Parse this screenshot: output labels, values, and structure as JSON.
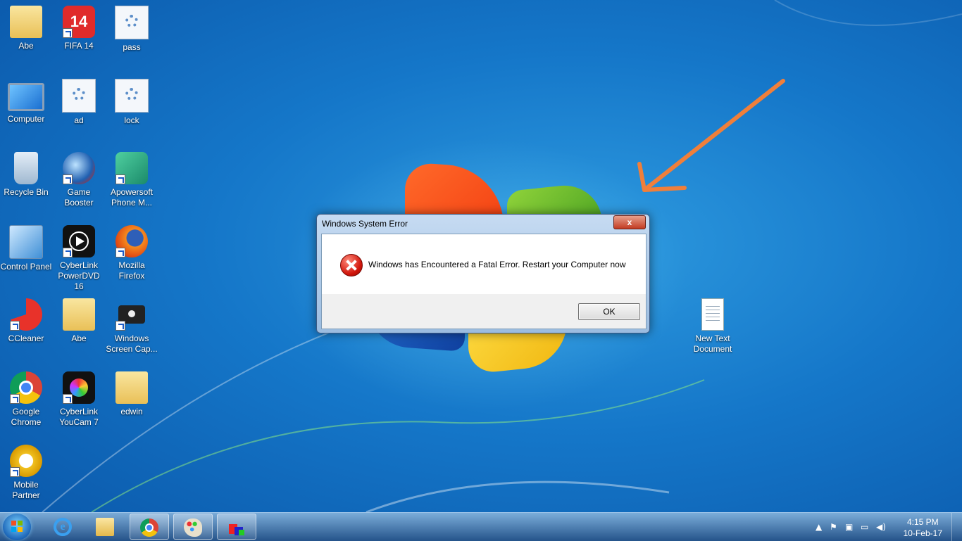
{
  "desktop_icons": [
    {
      "label": "Abe",
      "icon": "user-folder-icon"
    },
    {
      "label": "FIFA 14",
      "icon": "fifa-14-icon"
    },
    {
      "label": "pass",
      "icon": "settings-file-icon"
    },
    {
      "label": "Computer",
      "icon": "computer-icon"
    },
    {
      "label": "ad",
      "icon": "settings-file-icon"
    },
    {
      "label": "lock",
      "icon": "settings-file-icon"
    },
    {
      "label": "Recycle Bin",
      "icon": "recycle-bin-icon"
    },
    {
      "label": "Game Booster",
      "icon": "game-booster-icon"
    },
    {
      "label": "Apowersoft Phone M...",
      "icon": "apowersoft-icon"
    },
    {
      "label": "Control Panel",
      "icon": "control-panel-icon"
    },
    {
      "label": "CyberLink PowerDVD 16",
      "icon": "powerdvd-icon"
    },
    {
      "label": "Mozilla Firefox",
      "icon": "firefox-icon"
    },
    {
      "label": "CCleaner",
      "icon": "ccleaner-icon"
    },
    {
      "label": "Abe",
      "icon": "folder-icon"
    },
    {
      "label": "Windows Screen Cap...",
      "icon": "camera-icon"
    },
    {
      "label": "Google Chrome",
      "icon": "chrome-icon"
    },
    {
      "label": "CyberLink YouCam 7",
      "icon": "youcam-icon"
    },
    {
      "label": "edwin",
      "icon": "folder-icon"
    },
    {
      "label": "Mobile Partner",
      "icon": "mobile-partner-icon"
    },
    {
      "label": "New Text Document",
      "icon": "text-document-icon"
    }
  ],
  "dialog": {
    "title": "Windows System Error",
    "close_label": "x",
    "message": "Windows has Encountered a Fatal Error. Restart your Computer now",
    "ok_label": "OK",
    "icon": "error-icon"
  },
  "taskbar": {
    "pinned": [
      "internet-explorer-icon",
      "windows-explorer-icon",
      "chrome-icon",
      "paint-icon",
      "app-icon"
    ],
    "tray_icons": [
      "show-hidden-icon",
      "action-center-flag-icon",
      "usb-icon",
      "network-icon",
      "volume-icon"
    ],
    "time": "4:15 PM",
    "date": "10-Feb-17"
  },
  "colors": {
    "wallpaper": "#1577c9",
    "arrow": "#f07f3a",
    "error_red": "#d0140a"
  }
}
